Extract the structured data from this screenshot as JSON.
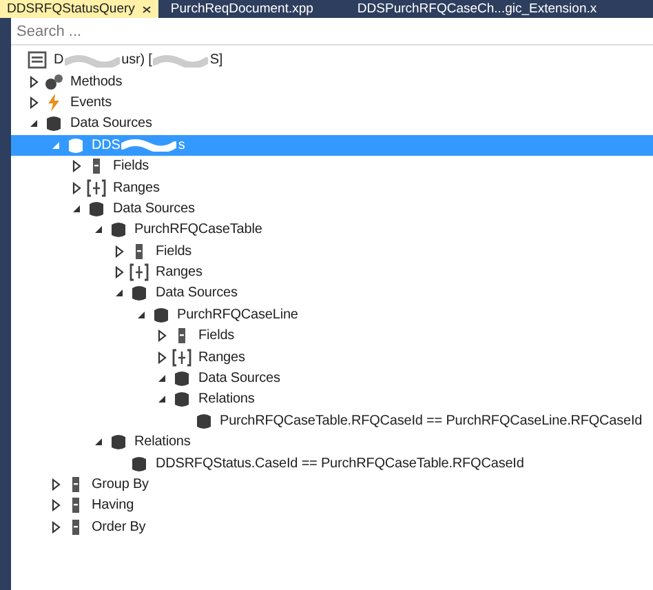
{
  "tabs": [
    {
      "label": "DDSRFQStatusQuery",
      "selected": true
    },
    {
      "label": "PurchReqDocument.xpp",
      "selected": false
    },
    {
      "label": "DDSPurchRFQCaseCh...gic_Extension.x",
      "selected": false
    }
  ],
  "search": {
    "placeholder": "Search ..."
  },
  "tree": [
    {
      "segments": [
        "D",
        "usr) [",
        "S]"
      ],
      "kind": "root",
      "selected": false,
      "children": [
        {
          "segments": [
            "Methods"
          ],
          "kind": "methods",
          "expanded": false,
          "selected": false
        },
        {
          "segments": [
            "Events"
          ],
          "kind": "events",
          "expanded": false,
          "selected": false
        },
        {
          "segments": [
            "Data Sources"
          ],
          "kind": "datasource",
          "expanded": true,
          "selected": false,
          "children": [
            {
              "segments": [
                "DDS",
                "s"
              ],
              "kind": "datasource",
              "expanded": true,
              "selected": true,
              "children": [
                {
                  "segments": [
                    "Fields"
                  ],
                  "kind": "field",
                  "expanded": false,
                  "selected": false
                },
                {
                  "segments": [
                    "Ranges"
                  ],
                  "kind": "range",
                  "expanded": false,
                  "selected": false
                },
                {
                  "segments": [
                    "Data Sources"
                  ],
                  "kind": "datasource",
                  "expanded": true,
                  "selected": false,
                  "children": [
                    {
                      "segments": [
                        "PurchRFQCaseTable"
                      ],
                      "kind": "datasource",
                      "expanded": true,
                      "selected": false,
                      "children": [
                        {
                          "segments": [
                            "Fields"
                          ],
                          "kind": "field",
                          "expanded": false,
                          "selected": false
                        },
                        {
                          "segments": [
                            "Ranges"
                          ],
                          "kind": "range",
                          "expanded": false,
                          "selected": false
                        },
                        {
                          "segments": [
                            "Data Sources"
                          ],
                          "kind": "datasource",
                          "expanded": true,
                          "selected": false,
                          "children": [
                            {
                              "segments": [
                                "PurchRFQCaseLine"
                              ],
                              "kind": "datasource",
                              "expanded": true,
                              "selected": false,
                              "children": [
                                {
                                  "segments": [
                                    "Fields"
                                  ],
                                  "kind": "field",
                                  "expanded": false,
                                  "selected": false
                                },
                                {
                                  "segments": [
                                    "Ranges"
                                  ],
                                  "kind": "range",
                                  "expanded": false,
                                  "selected": false
                                },
                                {
                                  "segments": [
                                    "Data Sources"
                                  ],
                                  "kind": "datasource",
                                  "expanded": true,
                                  "selected": false
                                },
                                {
                                  "segments": [
                                    "Relations"
                                  ],
                                  "kind": "datasource",
                                  "expanded": true,
                                  "selected": false,
                                  "children": [
                                    {
                                      "segments": [
                                        "PurchRFQCaseTable.RFQCaseId == PurchRFQCaseLine.RFQCaseId"
                                      ],
                                      "kind": "datasource",
                                      "selected": false
                                    }
                                  ]
                                }
                              ]
                            }
                          ]
                        }
                      ]
                    },
                    {
                      "segments": [
                        "Relations"
                      ],
                      "kind": "datasource",
                      "expanded": true,
                      "selected": false,
                      "children": [
                        {
                          "segments": [
                            "DDSRFQStatus.CaseId == PurchRFQCaseTable.RFQCaseId"
                          ],
                          "kind": "datasource",
                          "selected": false
                        }
                      ]
                    }
                  ]
                }
              ]
            },
            {
              "segments": [
                "Group By"
              ],
              "kind": "field",
              "expanded": false,
              "selected": false
            },
            {
              "segments": [
                "Having"
              ],
              "kind": "field",
              "expanded": false,
              "selected": false
            },
            {
              "segments": [
                "Order By"
              ],
              "kind": "field",
              "expanded": false,
              "selected": false
            }
          ]
        }
      ]
    }
  ]
}
